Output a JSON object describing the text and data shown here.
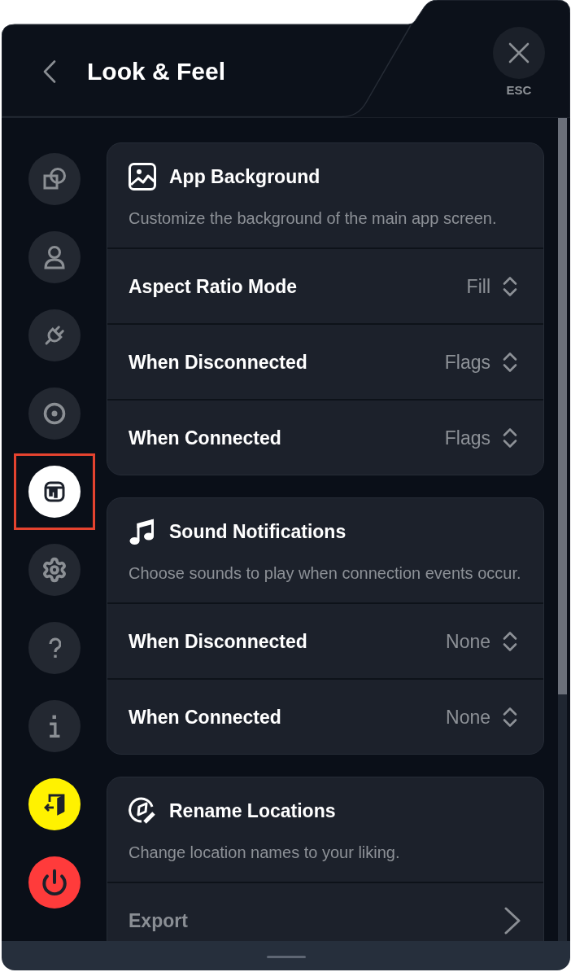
{
  "header": {
    "title": "Look & Feel",
    "close_hint": "ESC"
  },
  "sidebar": {
    "items": [
      {
        "selected": false,
        "highlighted": false
      },
      {
        "selected": false,
        "highlighted": false
      },
      {
        "selected": false,
        "highlighted": false
      },
      {
        "selected": false,
        "highlighted": false
      },
      {
        "selected": true,
        "highlighted": true
      },
      {
        "selected": false,
        "highlighted": false
      },
      {
        "selected": false,
        "highlighted": false
      },
      {
        "selected": false,
        "highlighted": false
      },
      {
        "selected": false,
        "highlighted": false,
        "color": "#fff200"
      },
      {
        "selected": false,
        "highlighted": false,
        "color": "#ff3b3b"
      }
    ]
  },
  "sections": [
    {
      "title": "App Background",
      "description": "Customize the background of the main app screen.",
      "rows": [
        {
          "kind": "select",
          "label": "Aspect Ratio Mode",
          "value": "Fill",
          "disabled": false
        },
        {
          "kind": "select",
          "label": "When Disconnected",
          "value": "Flags",
          "disabled": false
        },
        {
          "kind": "select",
          "label": "When Connected",
          "value": "Flags",
          "disabled": false
        }
      ]
    },
    {
      "title": "Sound Notifications",
      "description": "Choose sounds to play when connection events occur.",
      "rows": [
        {
          "kind": "select",
          "label": "When Disconnected",
          "value": "None",
          "disabled": false
        },
        {
          "kind": "select",
          "label": "When Connected",
          "value": "None",
          "disabled": false
        }
      ]
    },
    {
      "title": "Rename Locations",
      "description": "Change location names to your liking.",
      "rows": [
        {
          "kind": "link",
          "label": "Export",
          "disabled": true
        }
      ]
    }
  ]
}
